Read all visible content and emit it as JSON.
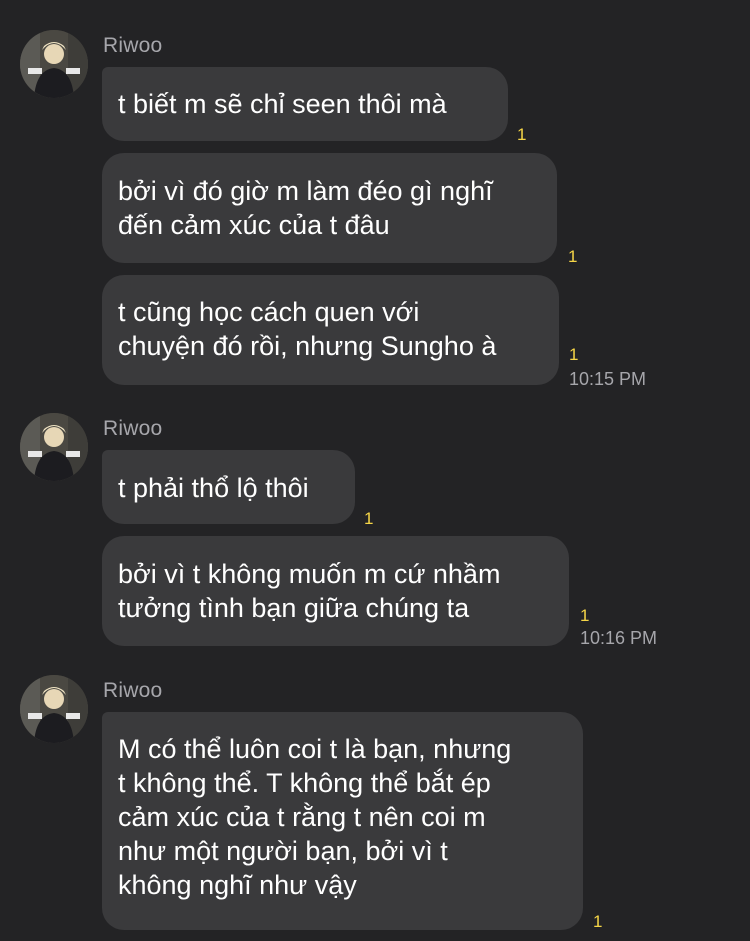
{
  "conversation": {
    "groups": [
      {
        "sender": "Riwoo",
        "messages": [
          {
            "lines": [
              "t biết m sẽ chỉ seen thôi mà"
            ],
            "unread": "1"
          },
          {
            "lines": [
              "bởi vì đó giờ m làm đéo gì nghĩ",
              "đến cảm xúc của t đâu"
            ],
            "unread": "1"
          },
          {
            "lines": [
              "t cũng học cách quen với",
              "chuyện đó rồi, nhưng Sungho à"
            ],
            "unread": "1",
            "time": "10:15 PM"
          }
        ]
      },
      {
        "sender": "Riwoo",
        "messages": [
          {
            "lines": [
              "t phải thổ lộ thôi"
            ],
            "unread": "1"
          },
          {
            "lines": [
              "bởi vì t không muốn m cứ nhầm",
              "tưởng tình bạn giữa chúng ta"
            ],
            "unread": "1",
            "time": "10:16 PM"
          }
        ]
      },
      {
        "sender": "Riwoo",
        "messages": [
          {
            "lines": [
              "M có thể luôn coi t là bạn, nhưng",
              "t không thể. T không thể bắt ép",
              "cảm xúc của t rằng t nên coi m",
              "như một người bạn, bởi vì t",
              "không nghĩ như vậy"
            ],
            "unread": "1"
          }
        ]
      }
    ]
  },
  "colors": {
    "background": "#232325",
    "bubble": "#3a3a3c",
    "sender_name": "#a6a6ab",
    "unread_count": "#f5d547",
    "timestamp": "#a6a6ab"
  },
  "icons": {
    "avatar": "profile-photo-avatar"
  }
}
